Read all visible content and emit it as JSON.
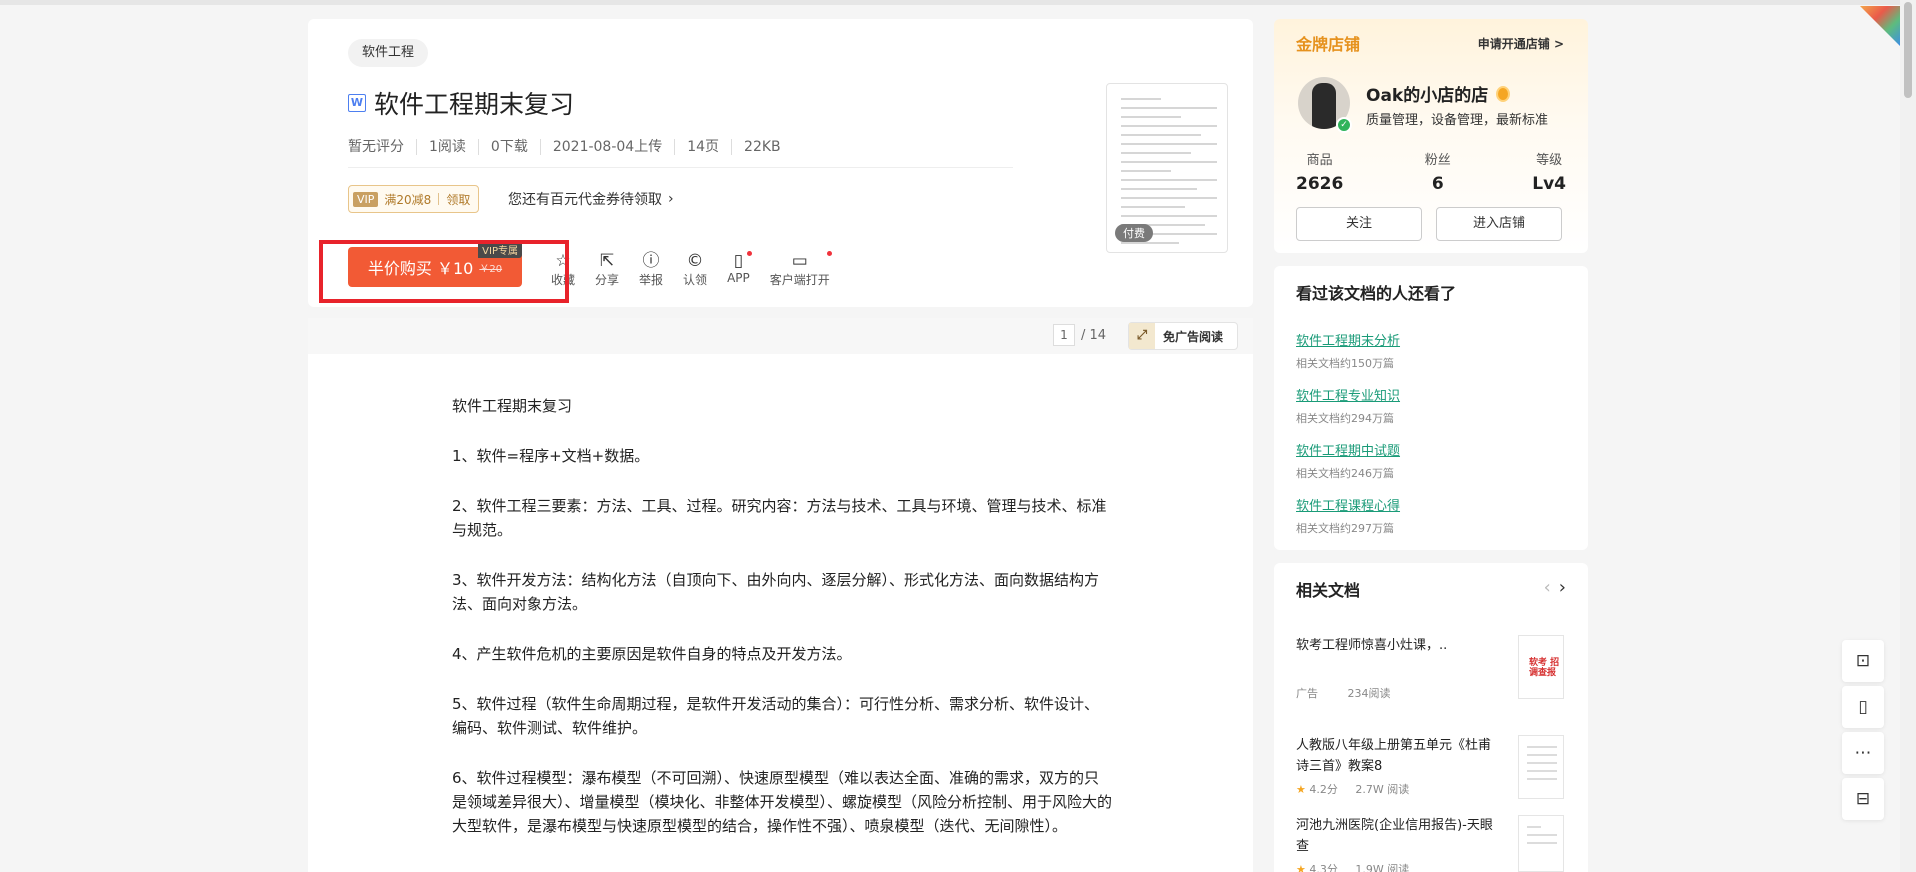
{
  "document": {
    "tag": "软件工程",
    "title": "软件工程期末复习",
    "file_type_icon": "W",
    "meta": [
      "暂无评分",
      "1阅读",
      "0下载",
      "2021-08-04上传",
      "14页",
      "22KB"
    ],
    "coupon": {
      "vip": "VIP",
      "text": "满20减8",
      "action": "领取"
    },
    "coupon_hint": "您还有百元代金券待领取",
    "buy": {
      "label": "半价购买 ￥10",
      "old_price": "￥20",
      "vip_tag": "VIP专属"
    },
    "actions": [
      {
        "label": "收藏",
        "icon": "star-icon"
      },
      {
        "label": "分享",
        "icon": "share-icon"
      },
      {
        "label": "举报",
        "icon": "report-icon"
      },
      {
        "label": "认领",
        "icon": "copyright-icon"
      },
      {
        "label": "APP",
        "icon": "phone-icon"
      },
      {
        "label": "客户端打开",
        "icon": "monitor-icon"
      }
    ],
    "thumb_badge": "付费"
  },
  "reader": {
    "current_page": "1",
    "total_pages": "/ 14",
    "no_ad_label": "免广告阅读"
  },
  "content": {
    "paragraphs": [
      "软件工程期末复习",
      "1、软件=程序+文档+数据。",
      "2、软件工程三要素：方法、工具、过程。研究内容：方法与技术、工具与环境、管理与技术、标准与规范。",
      "3、软件开发方法：结构化方法（自顶向下、由外向内、逐层分解）、形式化方法、面向数据结构方法、面向对象方法。",
      "4、产生软件危机的主要原因是软件自身的特点及开发方法。",
      "5、软件过程（软件生命周期过程，是软件开发活动的集合）：可行性分析、需求分析、软件设计、编码、软件测试、软件维护。",
      "6、软件过程模型：瀑布模型（不可回溯）、快速原型模型（难以表达全面、准确的需求，双方的只是领域差异很大）、增量模型（模块化、非整体开发模型）、螺旋模型（风险分析控制、用于风险大的大型软件，是瀑布模型与快速原型模型的结合，操作性不强）、喷泉模型（迭代、无间隙性）。"
    ]
  },
  "shop": {
    "header": "金牌店铺",
    "open_link": "申请开通店铺 >",
    "name": "Oak的小店的店",
    "desc": "质量管理，设备管理，最新标准",
    "stats": [
      {
        "label": "商品",
        "value": "2626"
      },
      {
        "label": "粉丝",
        "value": "6"
      },
      {
        "label": "等级",
        "value": "Lv4"
      }
    ],
    "follow": "关注",
    "enter": "进入店铺"
  },
  "viewed": {
    "title": "看过该文档的人还看了",
    "items": [
      {
        "title": "软件工程期末分析",
        "sub": "相关文档约150万篇"
      },
      {
        "title": "软件工程专业知识",
        "sub": "相关文档约294万篇"
      },
      {
        "title": "软件工程期中试题",
        "sub": "相关文档约246万篇"
      },
      {
        "title": "软件工程课程心得",
        "sub": "相关文档约297万篇"
      }
    ]
  },
  "related": {
    "title": "相关文档",
    "items": [
      {
        "title": "软考工程师惊喜小灶课，..",
        "meta_a": "广告",
        "meta_b": "234阅读",
        "thumb_text": "软考 招调查报"
      },
      {
        "title": "人教版八年级上册第五单元《杜甫诗三首》教案8",
        "rating": "4.2分",
        "reads": "2.7W 阅读"
      },
      {
        "title": "河池九洲医院(企业信用报告)-天眼查",
        "rating": "4.3分",
        "reads": "1.9W 阅读"
      }
    ]
  },
  "colors": {
    "accent_orange": "#f25a35",
    "link_green": "#1a9b78",
    "gold": "#e6921e",
    "highlight_red": "#e8232b"
  }
}
